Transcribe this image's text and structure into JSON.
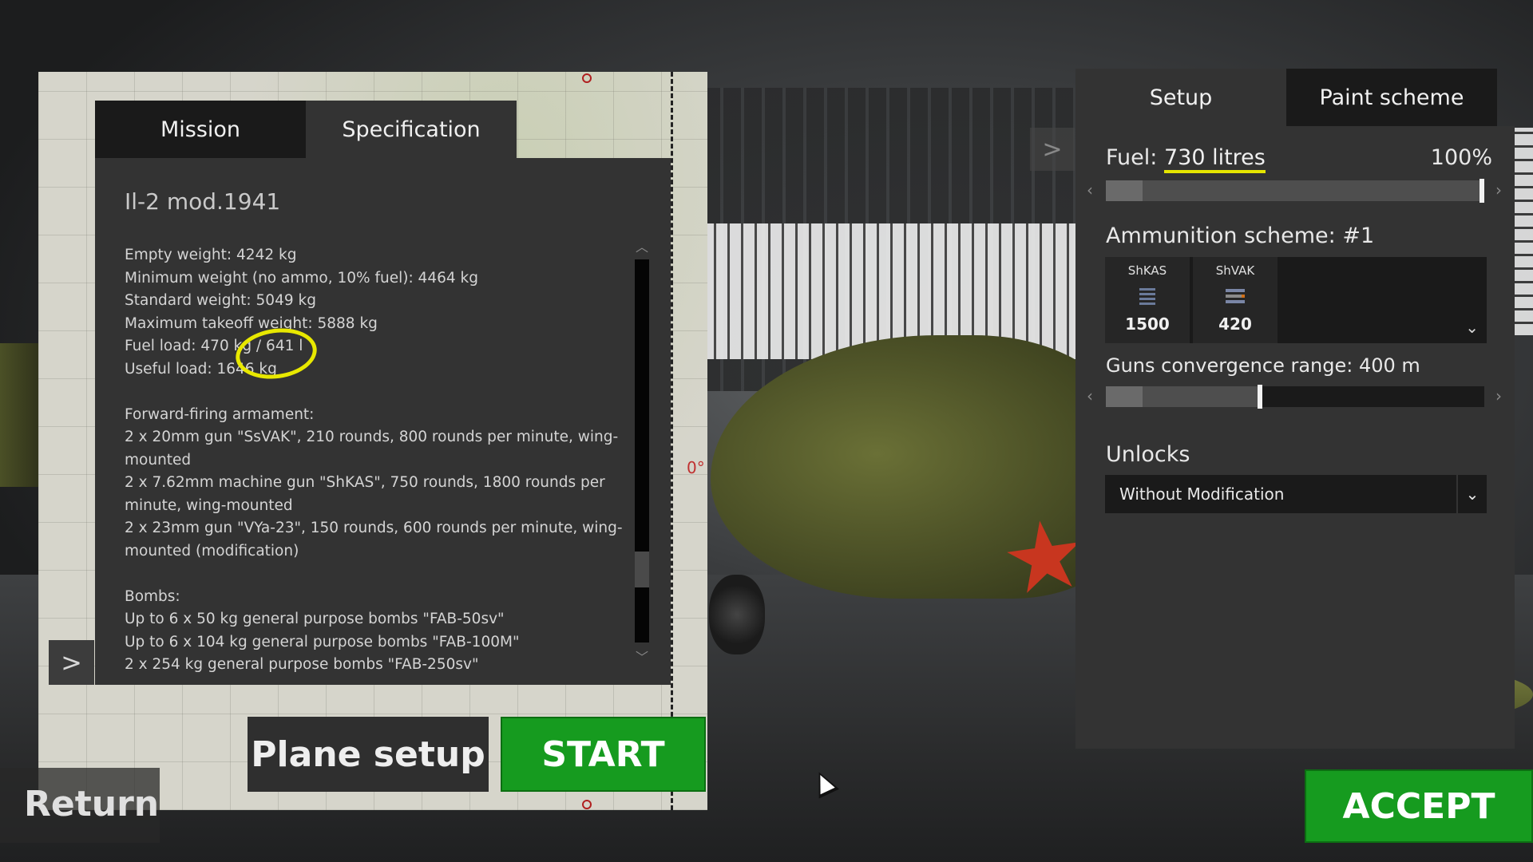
{
  "map": {
    "heading_readout": "0°"
  },
  "spec_panel": {
    "tabs": [
      {
        "label": "Mission",
        "active": true
      },
      {
        "label": "Specification",
        "active": false
      }
    ],
    "plane_name": "Il-2 mod.1941",
    "lines": {
      "empty_weight": "Empty weight: 4242 kg",
      "min_weight": "Minimum weight (no ammo, 10% fuel): 4464 kg",
      "std_weight": "Standard weight: 5049 kg",
      "max_takeoff": "Maximum takeoff weight: 5888 kg",
      "fuel_load": "Fuel load: 470 kg / 641 l",
      "useful_load": "Useful load: 1646 kg",
      "armament_title": "Forward-firing armament:",
      "arm_1": "2 x 20mm gun \"SsVAK\", 210 rounds, 800 rounds per minute, wing-mounted",
      "arm_2": "2 x 7.62mm machine gun \"ShKAS\", 750 rounds, 1800 rounds per minute, wing-mounted",
      "arm_3": "2 x 23mm gun \"VYa-23\", 150 rounds, 600 rounds per minute, wing-mounted (modification)",
      "bombs_title": "Bombs:",
      "bomb_1": "Up to 6 x 50 kg general purpose bombs \"FAB-50sv\"",
      "bomb_2": "Up to 6 x 104 kg general purpose bombs \"FAB-100M\"",
      "bomb_3": "2 x 254 kg general purpose bombs \"FAB-250sv\""
    },
    "scroll_up_icon": "chevron-up-icon",
    "scroll_down_icon": "chevron-down-icon"
  },
  "buttons": {
    "plane_setup": "Plane setup",
    "start": "START",
    "return": "Return",
    "accept": "ACCEPT",
    "side_arrow": ">",
    "hangar_next": ">"
  },
  "setup_panel": {
    "tabs": [
      {
        "label": "Setup",
        "active": true
      },
      {
        "label": "Paint scheme",
        "active": false
      }
    ],
    "fuel": {
      "label_prefix": "Fuel: ",
      "value": "730 litres",
      "percent": "100%",
      "fill_fraction": 1.0
    },
    "ammo": {
      "label": "Ammunition scheme: #1",
      "slots": [
        {
          "name": "ShKAS",
          "count": "1500"
        },
        {
          "name": "ShVAK",
          "count": "420"
        }
      ],
      "dropdown_icon": "chevron-down-icon"
    },
    "convergence": {
      "label": "Guns convergence range: 400 m",
      "fill_fraction": 0.4
    },
    "unlocks": {
      "label": "Unlocks",
      "selected": "Without Modification"
    }
  },
  "colors": {
    "accent_green": "#169b1f",
    "highlight_yellow": "#e8e800",
    "panel": "#333333",
    "panel_dark": "#1a1a1a"
  }
}
